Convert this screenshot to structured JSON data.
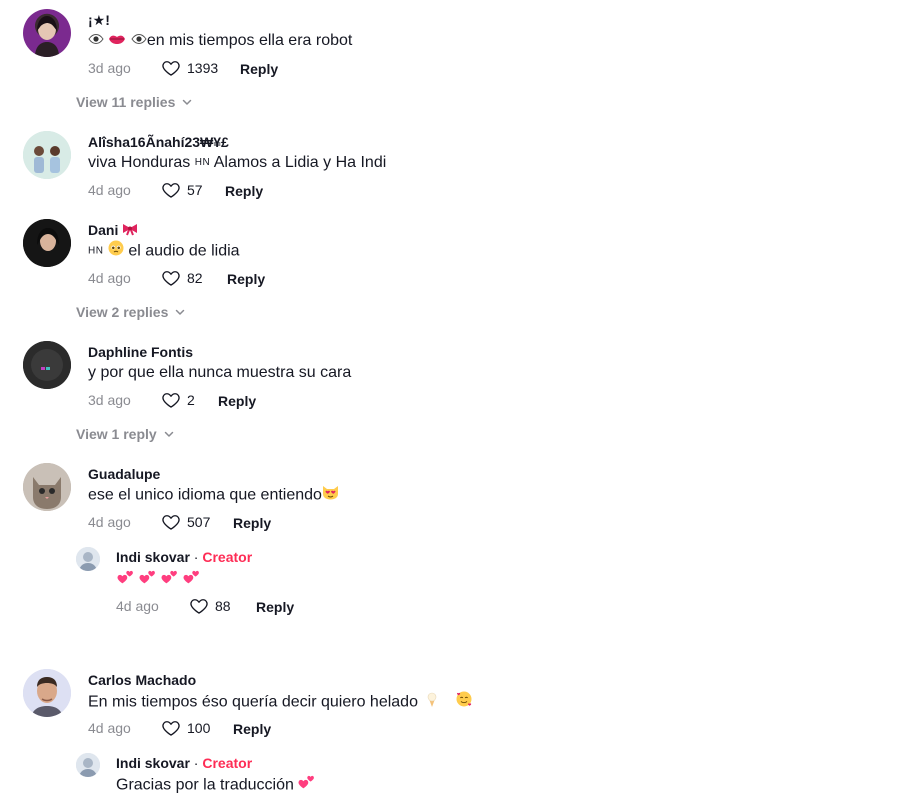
{
  "comments": [
    {
      "username": "¡★!",
      "text": "en mis tiempos ella era robot",
      "time": "3d ago",
      "likes": "1393",
      "reply": "Reply",
      "view_replies": "View 11 replies"
    },
    {
      "username": "Alîsha16Ãnahí23₩¥£",
      "text_pre": "viva Honduras",
      "flag": "HN",
      "text_post": "Alamos a Lidia y Ha Indi",
      "time": "4d ago",
      "likes": "57",
      "reply": "Reply"
    },
    {
      "username": "Dani",
      "flag": "HN",
      "text": "el audio de lidia",
      "time": "4d ago",
      "likes": "82",
      "reply": "Reply",
      "view_replies": "View 2 replies"
    },
    {
      "username": "Daphline Fontis",
      "text": "y por que ella nunca muestra su cara",
      "time": "3d ago",
      "likes": "2",
      "reply": "Reply",
      "view_replies": "View 1 reply"
    },
    {
      "username": "Guadalupe",
      "text": "ese el unico idioma que entiendo",
      "time": "4d ago",
      "likes": "507",
      "reply": "Reply",
      "creator_reply": {
        "username": "Indi skovar",
        "separator": " · ",
        "badge": "Creator",
        "time": "4d ago",
        "likes": "88",
        "reply": "Reply"
      }
    },
    {
      "username": "Carlos Machado",
      "text": "En mis tiempos éso quería decir quiero helado",
      "time": "4d ago",
      "likes": "100",
      "reply": "Reply",
      "creator_reply": {
        "username": "Indi skovar",
        "separator": " · ",
        "badge": "Creator",
        "text": "Gracias por la traducción"
      }
    }
  ],
  "colors": {
    "creator": "#fe2c55",
    "muted": "#8a8b91",
    "text": "#161823",
    "heart_emoji": "#ff3e7f"
  },
  "icons": [
    "heart-outline-icon",
    "chevron-down-icon",
    "eye-emoji-icon",
    "lips-emoji-icon",
    "bow-emoji-icon",
    "pleading-face-emoji-icon",
    "heart-eyes-cat-emoji-icon",
    "two-hearts-emoji-icon",
    "ice-cream-emoji-icon",
    "smiling-face-hearts-emoji-icon"
  ]
}
